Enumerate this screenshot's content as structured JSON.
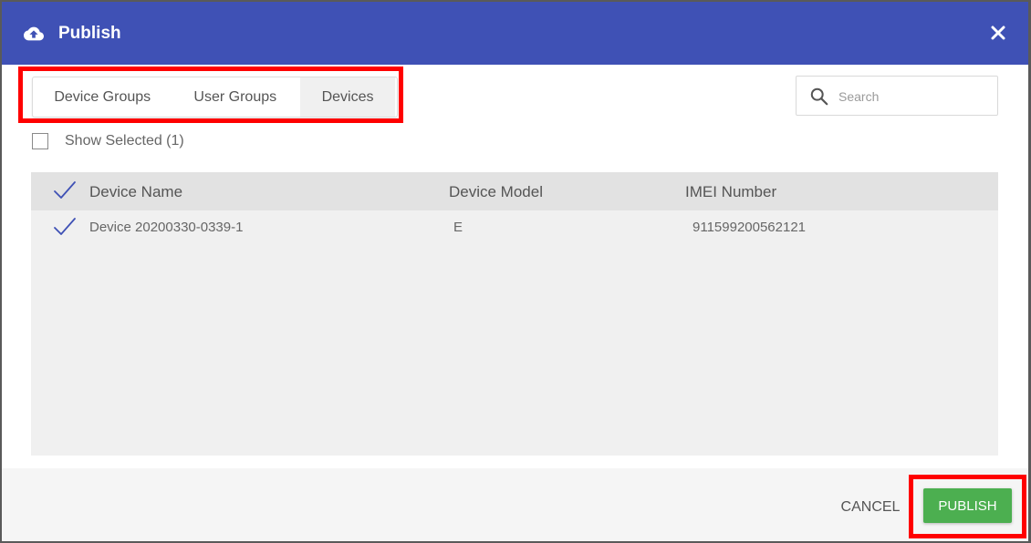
{
  "dialog": {
    "title": "Publish",
    "title_icon": "cloud-upload-icon",
    "close_icon": "close-icon"
  },
  "tabs": [
    {
      "label": "Device Groups",
      "active": false
    },
    {
      "label": "User Groups",
      "active": false
    },
    {
      "label": "Devices",
      "active": true
    }
  ],
  "search": {
    "placeholder": "Search",
    "value": ""
  },
  "show_selected": {
    "label": "Show Selected (1)",
    "checked": false
  },
  "table": {
    "columns": [
      "Device Name",
      "Device Model",
      "IMEI Number"
    ],
    "rows": [
      {
        "device_name": "Device 20200330-0339-1",
        "device_model": "E",
        "imei": "911599200562121",
        "selected": true
      }
    ]
  },
  "footer": {
    "cancel_label": "CANCEL",
    "publish_label": "PUBLISH"
  },
  "colors": {
    "header": "#3f51b5",
    "publish_button": "#4caf50",
    "highlight": "#ff0000",
    "checkmark": "#3f51b5"
  }
}
